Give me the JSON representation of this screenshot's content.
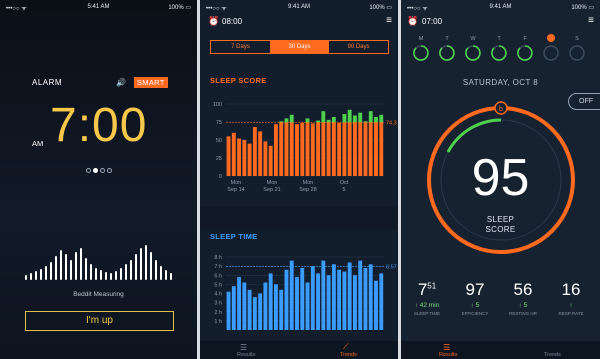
{
  "panels": {
    "alarm": {
      "status": {
        "signal": "•••○○ ᯤ",
        "time": "5:41 AM",
        "battery": "100% ▭"
      },
      "alarm_label": "ALARM",
      "speaker_icon": "speaker-icon",
      "smart_label": "SMART",
      "time": "7:00",
      "am_label": "AM",
      "page_dots": 4,
      "active_dot": 1,
      "measuring_label": "Beddit Measuring",
      "up_button": "I'm up",
      "colors": {
        "accent": "#f7c84a",
        "smart": "#ff6a1f"
      }
    },
    "trends": {
      "status": {
        "signal": "•••○○ ᯤ",
        "time": "9:41 AM",
        "battery": "100% ▭"
      },
      "alarm_time": "08:00",
      "segments": [
        "7 Days",
        "30 Days",
        "90 Days"
      ],
      "active_segment": 1,
      "sleep_score_title": "SLEEP SCORE",
      "sleep_time_title": "SLEEP TIME",
      "tabs": [
        "Results",
        "Trends"
      ],
      "active_tab": 1
    },
    "results": {
      "status": {
        "signal": "•••○○ ᯤ",
        "time": "9:41 AM",
        "battery": "100% ▭"
      },
      "alarm_time": "07:00",
      "week_days": [
        "M",
        "T",
        "W",
        "T",
        "F",
        "S",
        "S"
      ],
      "active_day": 5,
      "date": "SATURDAY, OCT 8",
      "toggle_label": "OFF",
      "score": "95",
      "score_label_1": "SLEEP",
      "score_label_2": "SCORE",
      "stats": [
        {
          "value": "7",
          "sup": "51",
          "delta": "↑ 42 min",
          "label": "SLEEP TIME"
        },
        {
          "value": "97",
          "sup": "",
          "delta": "↑ 5",
          "label": "EFFICIENCY"
        },
        {
          "value": "56",
          "sup": "",
          "delta": "↑ 5",
          "label": "RESTING HR"
        },
        {
          "value": "16",
          "sup": "",
          "delta": "↑",
          "label": "RESP RATE"
        }
      ],
      "tabs": [
        "Results",
        "Trends"
      ],
      "active_tab": 0,
      "colors": {
        "ring": "#ff6a1f",
        "green": "#4fd14f"
      }
    }
  },
  "chart_data": [
    {
      "type": "bar",
      "title": "SLEEP SCORE",
      "ylim": [
        0,
        100
      ],
      "yticks": [
        "100",
        "75",
        "50",
        "25",
        "0"
      ],
      "xlabels": [
        "Mon Sep 14",
        "Mon Sep 21",
        "Mon Sep 28",
        "Oct 5"
      ],
      "average_label": "74.3",
      "average": 74.3,
      "values": [
        55,
        60,
        52,
        50,
        45,
        68,
        62,
        48,
        42,
        72,
        76,
        80,
        85,
        72,
        74,
        80,
        73,
        77,
        90,
        78,
        82,
        74,
        86,
        92,
        84,
        88,
        76,
        90,
        82,
        85
      ]
    },
    {
      "type": "bar",
      "title": "SLEEP TIME",
      "ylim": [
        0,
        8
      ],
      "yticks": [
        "8 h",
        "7 h",
        "6 h",
        "5 h",
        "4 h",
        "3 h",
        "2 h",
        "1 h"
      ],
      "average_label": "6:57",
      "average": 6.95,
      "values": [
        4.2,
        4.8,
        5.8,
        5.2,
        4.4,
        3.6,
        4.0,
        5.2,
        6.2,
        5.0,
        4.4,
        6.6,
        7.6,
        5.8,
        6.8,
        5.2,
        7.0,
        6.2,
        7.6,
        6.0,
        7.2,
        6.6,
        6.4,
        7.4,
        6.0,
        7.6,
        6.8,
        7.2,
        5.4,
        6.2
      ]
    }
  ]
}
